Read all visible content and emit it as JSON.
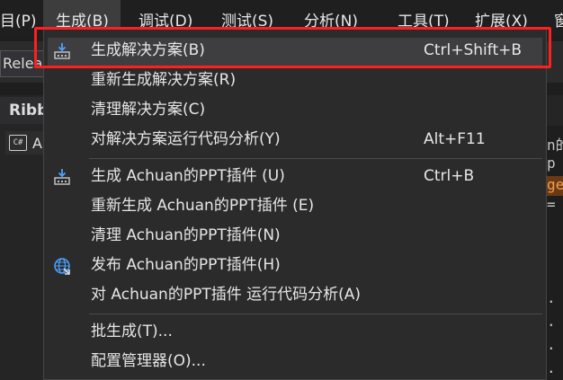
{
  "menubar": {
    "items": [
      {
        "label": "目(P)",
        "active": false
      },
      {
        "label": "生成(B)",
        "active": true
      },
      {
        "label": "调试(D)",
        "active": false
      },
      {
        "label": "测试(S)",
        "active": false
      },
      {
        "label": "分析(N)",
        "active": false
      },
      {
        "label": "工具(T)",
        "active": false
      },
      {
        "label": "扩展(X)",
        "active": false
      },
      {
        "label": "窗",
        "active": false
      }
    ]
  },
  "background": {
    "config_combo": "Releas",
    "panel_title": "Ribb",
    "tab_icon": "C#",
    "tab_label": "A",
    "code": [
      "n的",
      "p",
      "ge",
      "=",
      ". i",
      ". i",
      ". i",
      ". i"
    ]
  },
  "menu": {
    "items": [
      {
        "label": "生成解决方案(B)",
        "shortcut": "Ctrl+Shift+B",
        "icon": "build-icon"
      },
      {
        "label": "重新生成解决方案(R)",
        "shortcut": ""
      },
      {
        "label": "清理解决方案(C)",
        "shortcut": ""
      },
      {
        "label": "对解决方案运行代码分析(Y)",
        "shortcut": "Alt+F11"
      },
      {
        "label": "生成 Achuan的PPT插件 (U)",
        "shortcut": "Ctrl+B",
        "icon": "build-icon"
      },
      {
        "label": "重新生成 Achuan的PPT插件 (E)",
        "shortcut": ""
      },
      {
        "label": "清理 Achuan的PPT插件(N)",
        "shortcut": ""
      },
      {
        "label": "发布 Achuan的PPT插件(H)",
        "shortcut": "",
        "icon": "globe-icon"
      },
      {
        "label": "对 Achuan的PPT插件 运行代码分析(A)",
        "shortcut": ""
      },
      {
        "label": "批生成(T)...",
        "shortcut": ""
      },
      {
        "label": "配置管理器(O)...",
        "shortcut": ""
      }
    ]
  },
  "colors": {
    "highlight_border": "#ff1f1f",
    "menu_bg": "#2b2b2b",
    "selected_bg": "#3e3e40",
    "icon_blue": "#4aa3ff"
  }
}
